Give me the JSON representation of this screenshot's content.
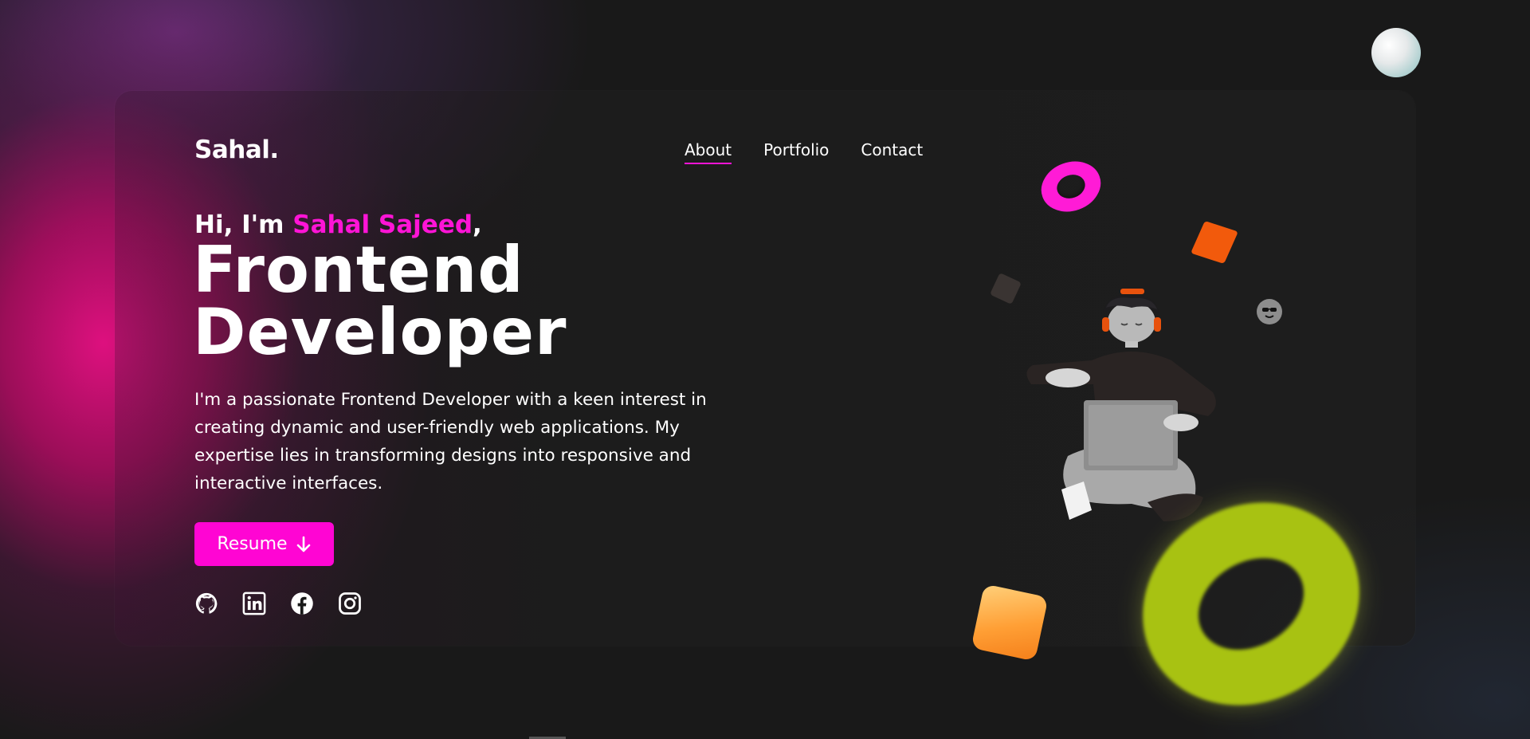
{
  "logo": "Sahal.",
  "nav": {
    "items": [
      "About",
      "Portfolio",
      "Contact"
    ],
    "active": "About"
  },
  "hero": {
    "greeting_prefix": "Hi, I'm ",
    "name": "Sahal Sajeed",
    "greeting_suffix": ",",
    "headline_line1": "Frontend",
    "headline_line2": "Developer",
    "bio": "I'm a passionate Frontend Developer with a keen interest in creating dynamic and user-friendly web applications. My expertise lies in transforming designs into responsive and interactive interfaces."
  },
  "resume_button": {
    "label": "Resume",
    "icon": "arrow-down-icon"
  },
  "socials": [
    "github-icon",
    "linkedin-icon",
    "facebook-icon",
    "instagram-icon"
  ],
  "colors": {
    "accent": "#ff14d6",
    "background": "#191919",
    "card": "#1e1e1e"
  }
}
